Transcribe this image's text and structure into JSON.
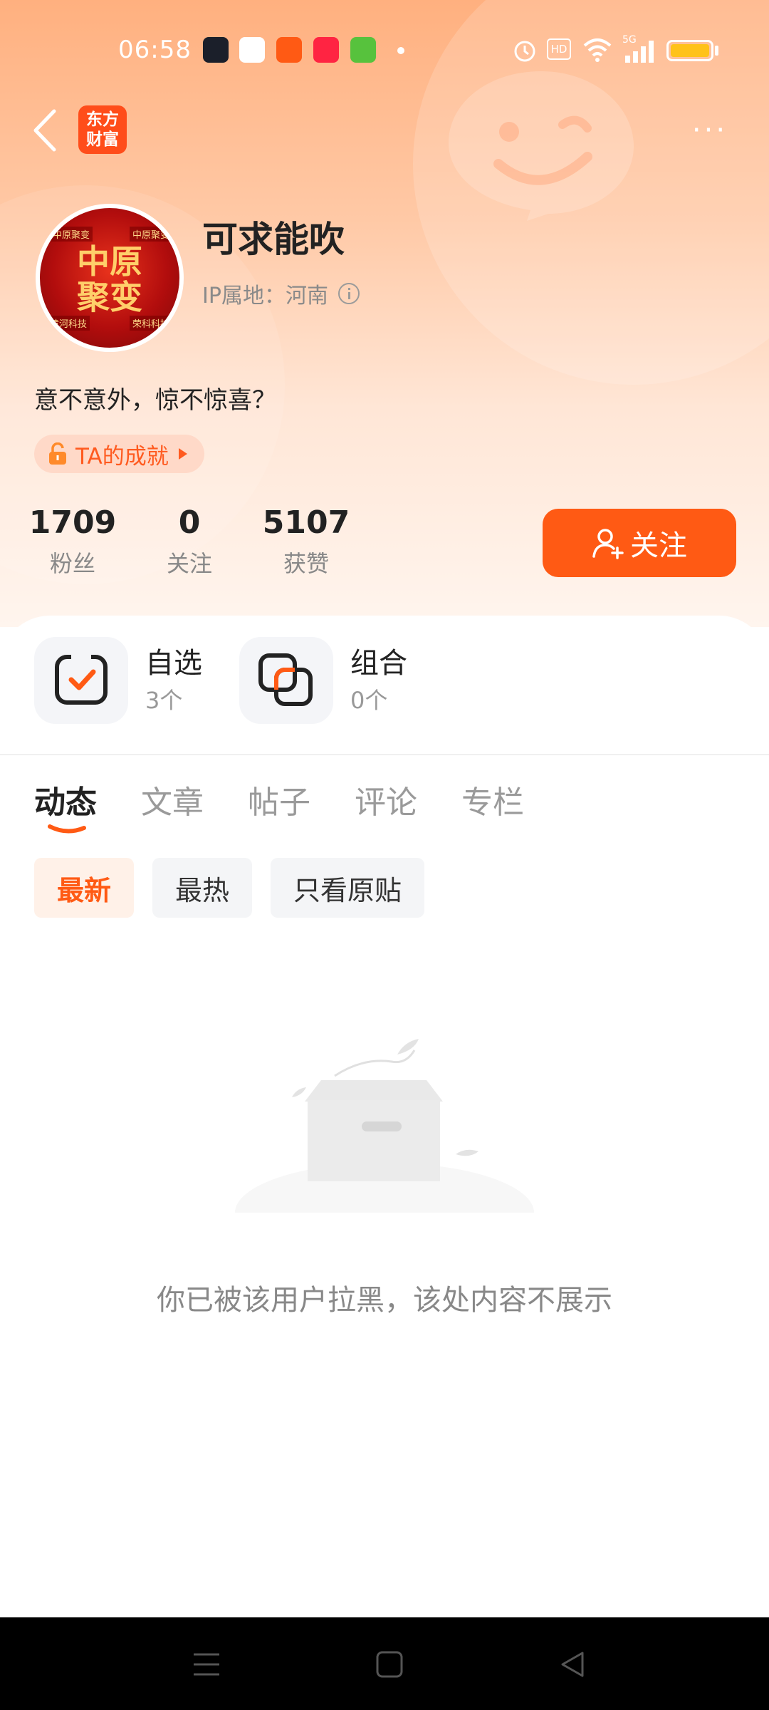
{
  "status_bar": {
    "time": "06:58",
    "network_label": "5G",
    "hd_label": "HD"
  },
  "nav": {
    "logo_text_line1": "东方",
    "logo_text_line2": "财富",
    "more_label": "···"
  },
  "profile": {
    "avatar_text_line1": "中原",
    "avatar_text_line2": "聚变",
    "avatar_tag_tl": "中原聚变",
    "avatar_tag_tr": "中原聚变",
    "avatar_tag_bl": "黄河科技",
    "avatar_tag_br": "荣科科技",
    "username": "可求能吹",
    "ip_location": "IP属地：河南",
    "bio": "意不意外，惊不惊喜？",
    "achievement_label": "TA的成就"
  },
  "stats": [
    {
      "value": "1709",
      "label": "粉丝"
    },
    {
      "value": "0",
      "label": "关注"
    },
    {
      "value": "5107",
      "label": "获赞"
    }
  ],
  "follow_button": {
    "label": "关注"
  },
  "assets": [
    {
      "title": "自选",
      "count": "3个",
      "icon": "checkbox-icon"
    },
    {
      "title": "组合",
      "count": "0个",
      "icon": "portfolio-icon"
    }
  ],
  "tabs": [
    {
      "label": "动态",
      "active": true
    },
    {
      "label": "文章",
      "active": false
    },
    {
      "label": "帖子",
      "active": false
    },
    {
      "label": "评论",
      "active": false
    },
    {
      "label": "专栏",
      "active": false
    }
  ],
  "filters": [
    {
      "label": "最新",
      "active": true
    },
    {
      "label": "最热",
      "active": false
    },
    {
      "label": "只看原贴",
      "active": false
    }
  ],
  "empty_state": {
    "message": "你已被该用户拉黑，该处内容不展示"
  },
  "colors": {
    "accent": "#ff5a14",
    "header_gradient_top": "#ffb07f",
    "text_primary": "#222222",
    "text_secondary": "#888888"
  }
}
